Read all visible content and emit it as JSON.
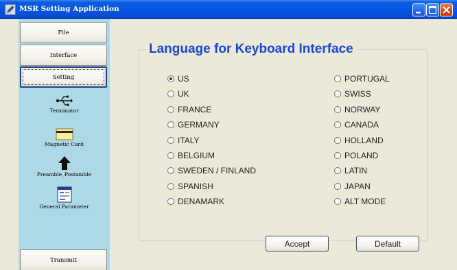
{
  "window": {
    "title": "MSR Setting Application",
    "icons": {
      "app": "app-pen-icon",
      "minimize": "minimize-icon",
      "maximize": "maximize-icon",
      "close": "close-icon"
    }
  },
  "sidebar": {
    "buttons": [
      {
        "label": "File"
      },
      {
        "label": "Interface"
      },
      {
        "label": "Setting"
      }
    ],
    "tools": [
      {
        "label": "Terminator",
        "icon": "usb-icon"
      },
      {
        "label": "Magnetic Card",
        "icon": "magnetic-card-icon"
      },
      {
        "label": "Preamble_Postamble",
        "icon": "arrow-up-icon"
      },
      {
        "label": "General Parameter",
        "icon": "general-parameter-icon"
      }
    ],
    "transmit": {
      "label": "Transmit"
    }
  },
  "main": {
    "group_title": "Language for Keyboard Interface",
    "selected": "US",
    "left_options": [
      "US",
      "UK",
      "FRANCE",
      "GERMANY",
      "ITALY",
      "BELGIUM",
      "SWEDEN / FINLAND",
      "SPANISH",
      "DENAMARK"
    ],
    "right_options": [
      "PORTUGAL",
      "SWISS",
      "NORWAY",
      "CANADA",
      "HOLLAND",
      "POLAND",
      "LATIN",
      "JAPAN",
      "ALT MODE"
    ],
    "accept_label": "Accept",
    "default_label": "Default"
  },
  "colors": {
    "title_bar": "#0554e4",
    "sidebar_bg": "#add8e6",
    "group_title": "#1746d4",
    "window_bg": "#ece9d8"
  }
}
